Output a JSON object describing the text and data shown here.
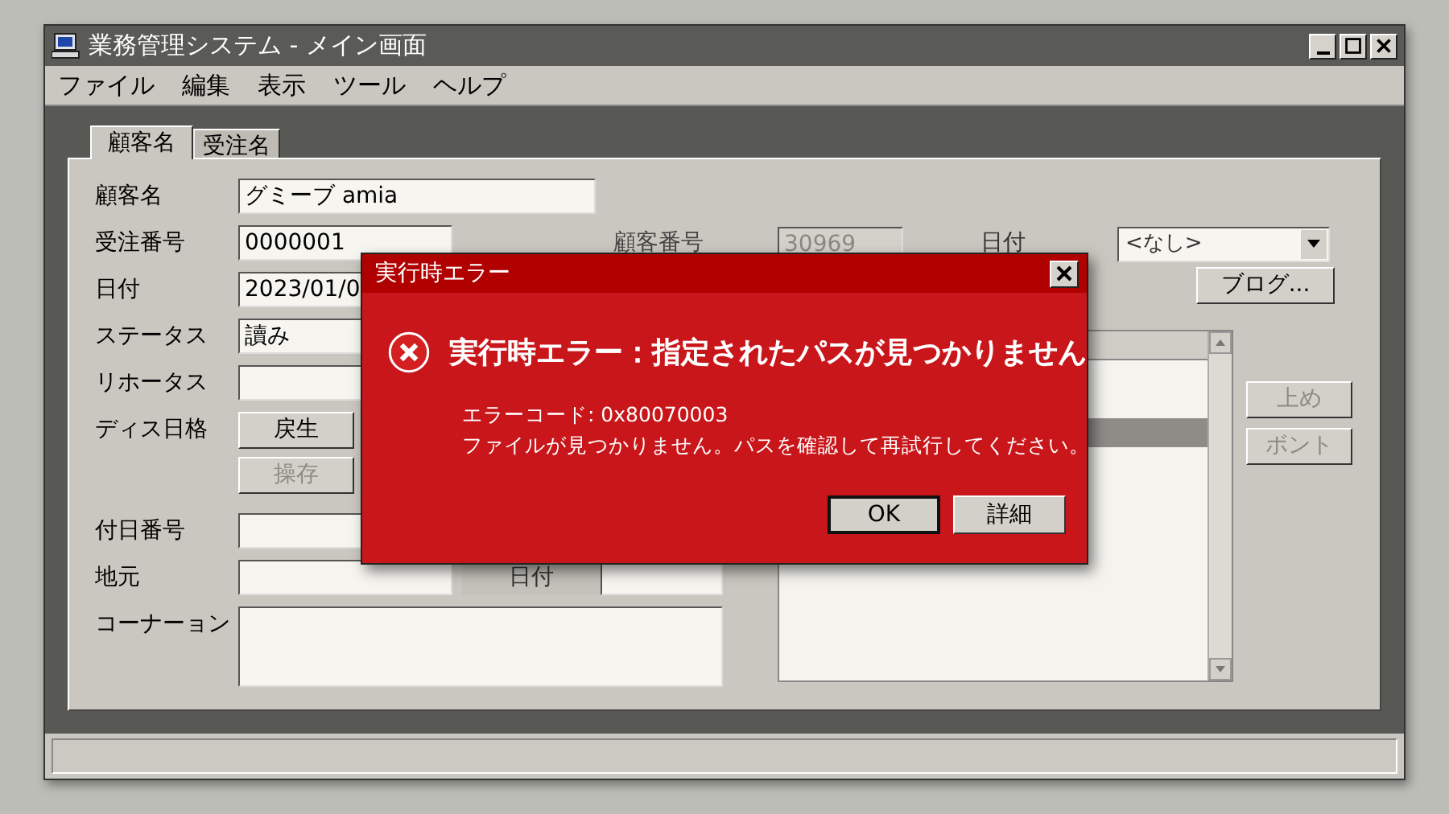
{
  "window": {
    "title": "業務管理システム - メイン画面"
  },
  "menu": [
    "ファイル",
    "編集",
    "表示",
    "ツール",
    "ヘルプ"
  ],
  "tabs": [
    {
      "label": "顧客名",
      "selected": true
    },
    {
      "label": "受注名",
      "selected": false
    }
  ],
  "form_rows": [
    {
      "kind": "long_field",
      "label": "顧客名",
      "value": "グミーブ amia"
    },
    {
      "kind": "field",
      "label": "受注番号",
      "value": "0000001",
      "side_label": "顧客番号"
    },
    {
      "kind": "field",
      "label": "日付",
      "value": "2023/01/0"
    },
    {
      "kind": "field",
      "label": "ステータス",
      "value": "讀み"
    },
    {
      "kind": "field",
      "label": "リホータス"
    },
    {
      "kind": "button",
      "label": "ディス日格",
      "button": "戻生",
      "disabled": false
    },
    {
      "kind": "button",
      "button": "操存",
      "disabled": true
    },
    {
      "kind": "field",
      "label": "付日番号"
    },
    {
      "kind": "field",
      "label": "地元",
      "side_label": "日付",
      "side_field": true
    },
    {
      "kind": "memo",
      "label": "コーナーョン"
    }
  ],
  "customer_number": {
    "value": "30969",
    "disabled": true
  },
  "date_filter": {
    "label": "日付",
    "value": "<なし>"
  },
  "blog_button": "ブログ...",
  "list": {
    "rows": [
      {
        "selected": false
      },
      {
        "selected": false
      },
      {
        "selected": true
      },
      {
        "selected": false
      }
    ]
  },
  "side_buttons": [
    {
      "label": "上め",
      "disabled": true
    },
    {
      "label": "ボント",
      "disabled": true
    }
  ],
  "dialog": {
    "title": "実行時エラー",
    "heading": "実行時エラー：指定されたパスが見つかりません",
    "lines": [
      "エラーコード: 0x80070003",
      "ファイルが見つかりません。パスを確認して再試行してください。"
    ],
    "buttons": [
      {
        "label": "OK",
        "default": true
      },
      {
        "label": "詳細",
        "default": false
      }
    ]
  }
}
